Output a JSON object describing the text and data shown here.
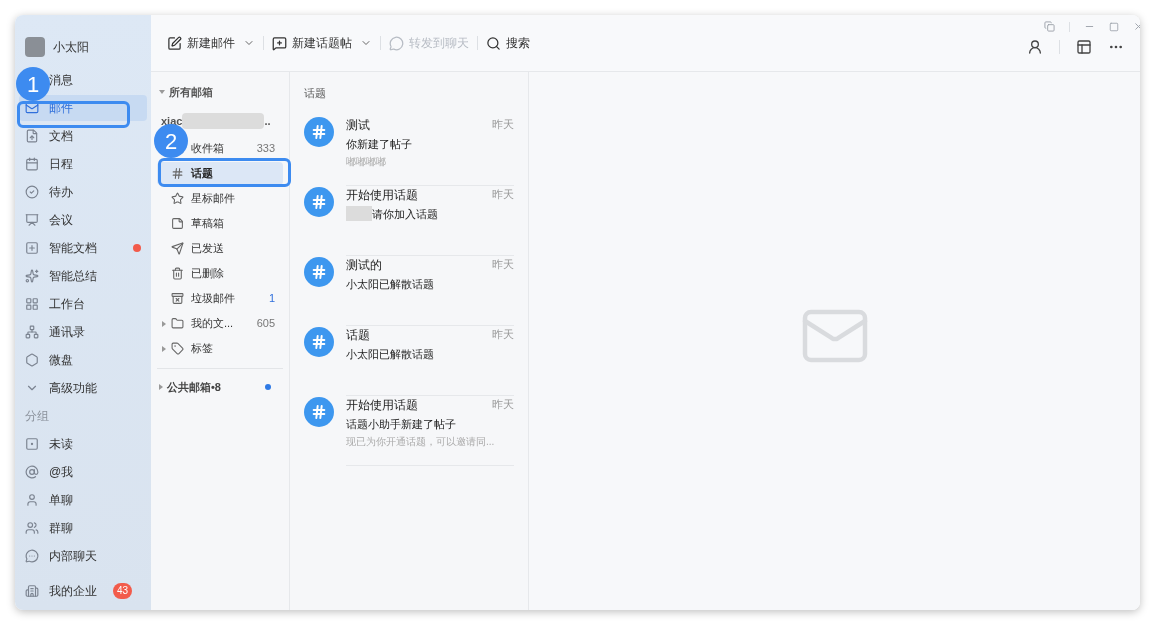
{
  "sidebar": {
    "user": "小太阳",
    "items": [
      {
        "label": "消息",
        "selected": false,
        "dot": false
      },
      {
        "label": "邮件",
        "selected": true,
        "dot": false
      },
      {
        "label": "文档",
        "selected": false,
        "dot": false
      },
      {
        "label": "日程",
        "selected": false,
        "dot": false
      },
      {
        "label": "待办",
        "selected": false,
        "dot": false
      },
      {
        "label": "会议",
        "selected": false,
        "dot": false
      },
      {
        "label": "智能文档",
        "selected": false,
        "dot": true
      },
      {
        "label": "智能总结",
        "selected": false,
        "dot": false
      },
      {
        "label": "工作台",
        "selected": false,
        "dot": false
      },
      {
        "label": "通讯录",
        "selected": false,
        "dot": false
      },
      {
        "label": "微盘",
        "selected": false,
        "dot": false
      },
      {
        "label": "高级功能",
        "selected": false,
        "dot": false
      }
    ],
    "group_label": "分组",
    "groups": [
      {
        "label": "未读"
      },
      {
        "label": "@我"
      },
      {
        "label": "单聊"
      },
      {
        "label": "群聊"
      },
      {
        "label": "内部聊天"
      }
    ],
    "footer": {
      "label": "我的企业",
      "badge": "43"
    }
  },
  "toolbar": {
    "buttons": [
      {
        "label": "新建邮件",
        "kind": "dropdown",
        "disabled": false
      },
      {
        "label": "新建话题帖",
        "kind": "dropdown",
        "disabled": false
      },
      {
        "label": "转发到聊天",
        "kind": "plain",
        "disabled": true
      },
      {
        "label": "搜索",
        "kind": "search",
        "disabled": false
      }
    ]
  },
  "folders": {
    "header": "所有邮箱",
    "account": "xiac",
    "account_suffix": "..",
    "items": [
      {
        "label": "收件箱",
        "count": "333",
        "highlight": false,
        "selected": false
      },
      {
        "label": "话题",
        "selected": true,
        "expandable": false
      },
      {
        "label": "星标邮件",
        "selected": false,
        "expandable": false
      },
      {
        "label": "草稿箱",
        "selected": false,
        "expandable": false
      },
      {
        "label": "已发送",
        "selected": false,
        "expandable": false
      },
      {
        "label": "已删除",
        "selected": false,
        "expandable": false
      },
      {
        "label": "垃圾邮件",
        "count": "1",
        "highlight": true,
        "selected": false,
        "expandable": false
      },
      {
        "label": "我的文...",
        "count": "605",
        "highlight": false,
        "selected": false,
        "expandable": true
      },
      {
        "label": "标签",
        "selected": false,
        "expandable": true
      }
    ],
    "public": {
      "label": "公共邮箱•8",
      "dot": true
    }
  },
  "topics": {
    "header": "话题",
    "items": [
      {
        "title": "测试",
        "time": "昨天",
        "line": "你新建了帖子",
        "preview": "嘟嘟嘟嘟",
        "redacted": false
      },
      {
        "title": "开始使用话题",
        "time": "昨天",
        "line": "请你加入话题",
        "redacted": true
      },
      {
        "title": "测试的",
        "time": "昨天",
        "line": "小太阳已解散话题",
        "redacted": false
      },
      {
        "title": "话题",
        "time": "昨天",
        "line": "小太阳已解散话题",
        "redacted": false
      },
      {
        "title": "开始使用话题",
        "time": "昨天",
        "line": "话题小助手新建了帖子",
        "preview": "现已为你开通话题，可以邀请同...",
        "redacted": false
      }
    ]
  },
  "callouts": [
    "1",
    "2"
  ]
}
